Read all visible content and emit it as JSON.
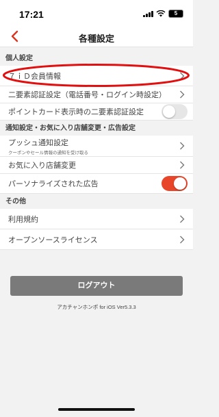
{
  "status": {
    "time": "17:21",
    "battery": "5"
  },
  "header": {
    "title": "各種設定"
  },
  "sections": {
    "personal": "個人設定",
    "notifications": "通知設定・お気に入り店舗変更・広告設定",
    "other": "その他"
  },
  "personal": {
    "id_info": "７ｉＤ会員情報",
    "two_factor": "二要素認証設定（電話番号・ログイン時設定）",
    "point_card_2fa": "ポイントカード表示時の二要素認証設定"
  },
  "notifications": {
    "push": "プッシュ通知設定",
    "push_sub": "クーポンやセール情報の通知を受け取る",
    "favorite_store": "お気に入り店舗変更",
    "personalized_ads": "パーソナライズされた広告"
  },
  "other": {
    "terms": "利用規約",
    "open_source": "オープンソースライセンス"
  },
  "toggles": {
    "point_card_2fa": false,
    "personalized_ads": true
  },
  "logout_label": "ログアウト",
  "version": "アカチャンホンポ for iOS Ver5.3.3",
  "colors": {
    "accent": "#e8462a",
    "highlight": "#e01010",
    "logout_bg": "#7a7a7a"
  }
}
